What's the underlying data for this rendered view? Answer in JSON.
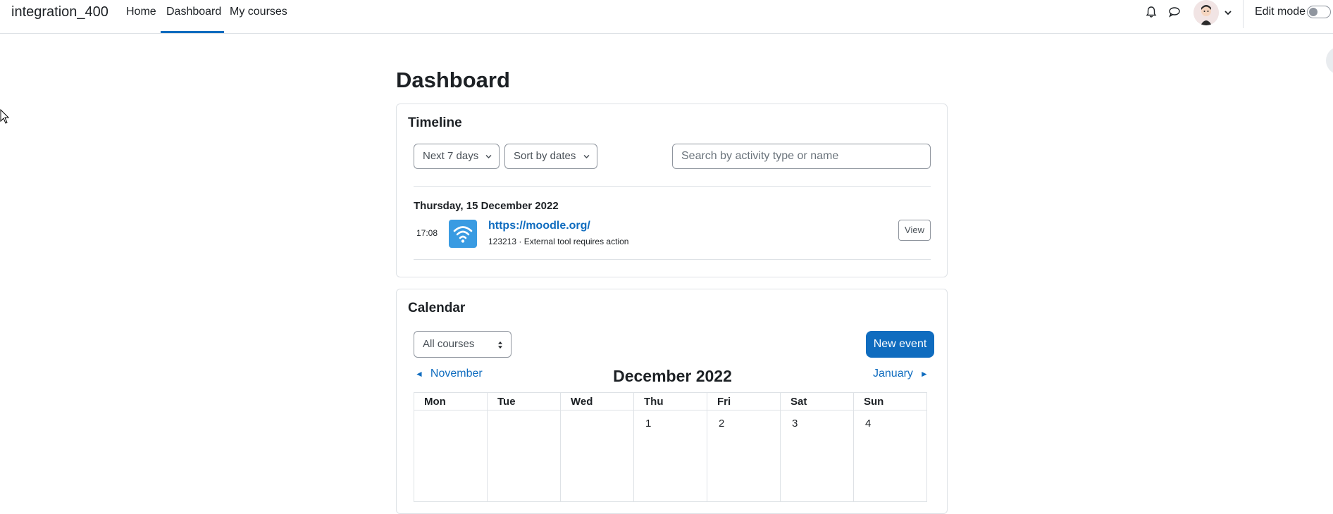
{
  "navbar": {
    "site_name": "integration_400",
    "links": [
      {
        "label": "Home"
      },
      {
        "label": "Dashboard",
        "active": true
      },
      {
        "label": "My courses"
      }
    ],
    "edit_mode_label": "Edit mode",
    "edit_mode_on": false,
    "accent_color": "#0f6cbf"
  },
  "page": {
    "title": "Dashboard"
  },
  "timeline": {
    "title": "Timeline",
    "filter_label": "Next 7 days",
    "sort_label": "Sort by dates",
    "search_placeholder": "Search by activity type or name",
    "date_heading": "Thursday, 15 December 2022",
    "event": {
      "time": "17:08",
      "name": "https://moodle.org/",
      "detail": "123213 · External tool requires action",
      "action_label": "View",
      "icon": "wifi-icon",
      "icon_color": "#399be2"
    }
  },
  "calendar": {
    "title": "Calendar",
    "course_filter": "All courses",
    "new_event_label": "New event",
    "prev_month": "November",
    "next_month": "January",
    "month_title": "December 2022",
    "weekdays": [
      "Mon",
      "Tue",
      "Wed",
      "Thu",
      "Fri",
      "Sat",
      "Sun"
    ],
    "first_week": [
      "",
      "",
      "",
      "1",
      "2",
      "3",
      "4"
    ]
  }
}
